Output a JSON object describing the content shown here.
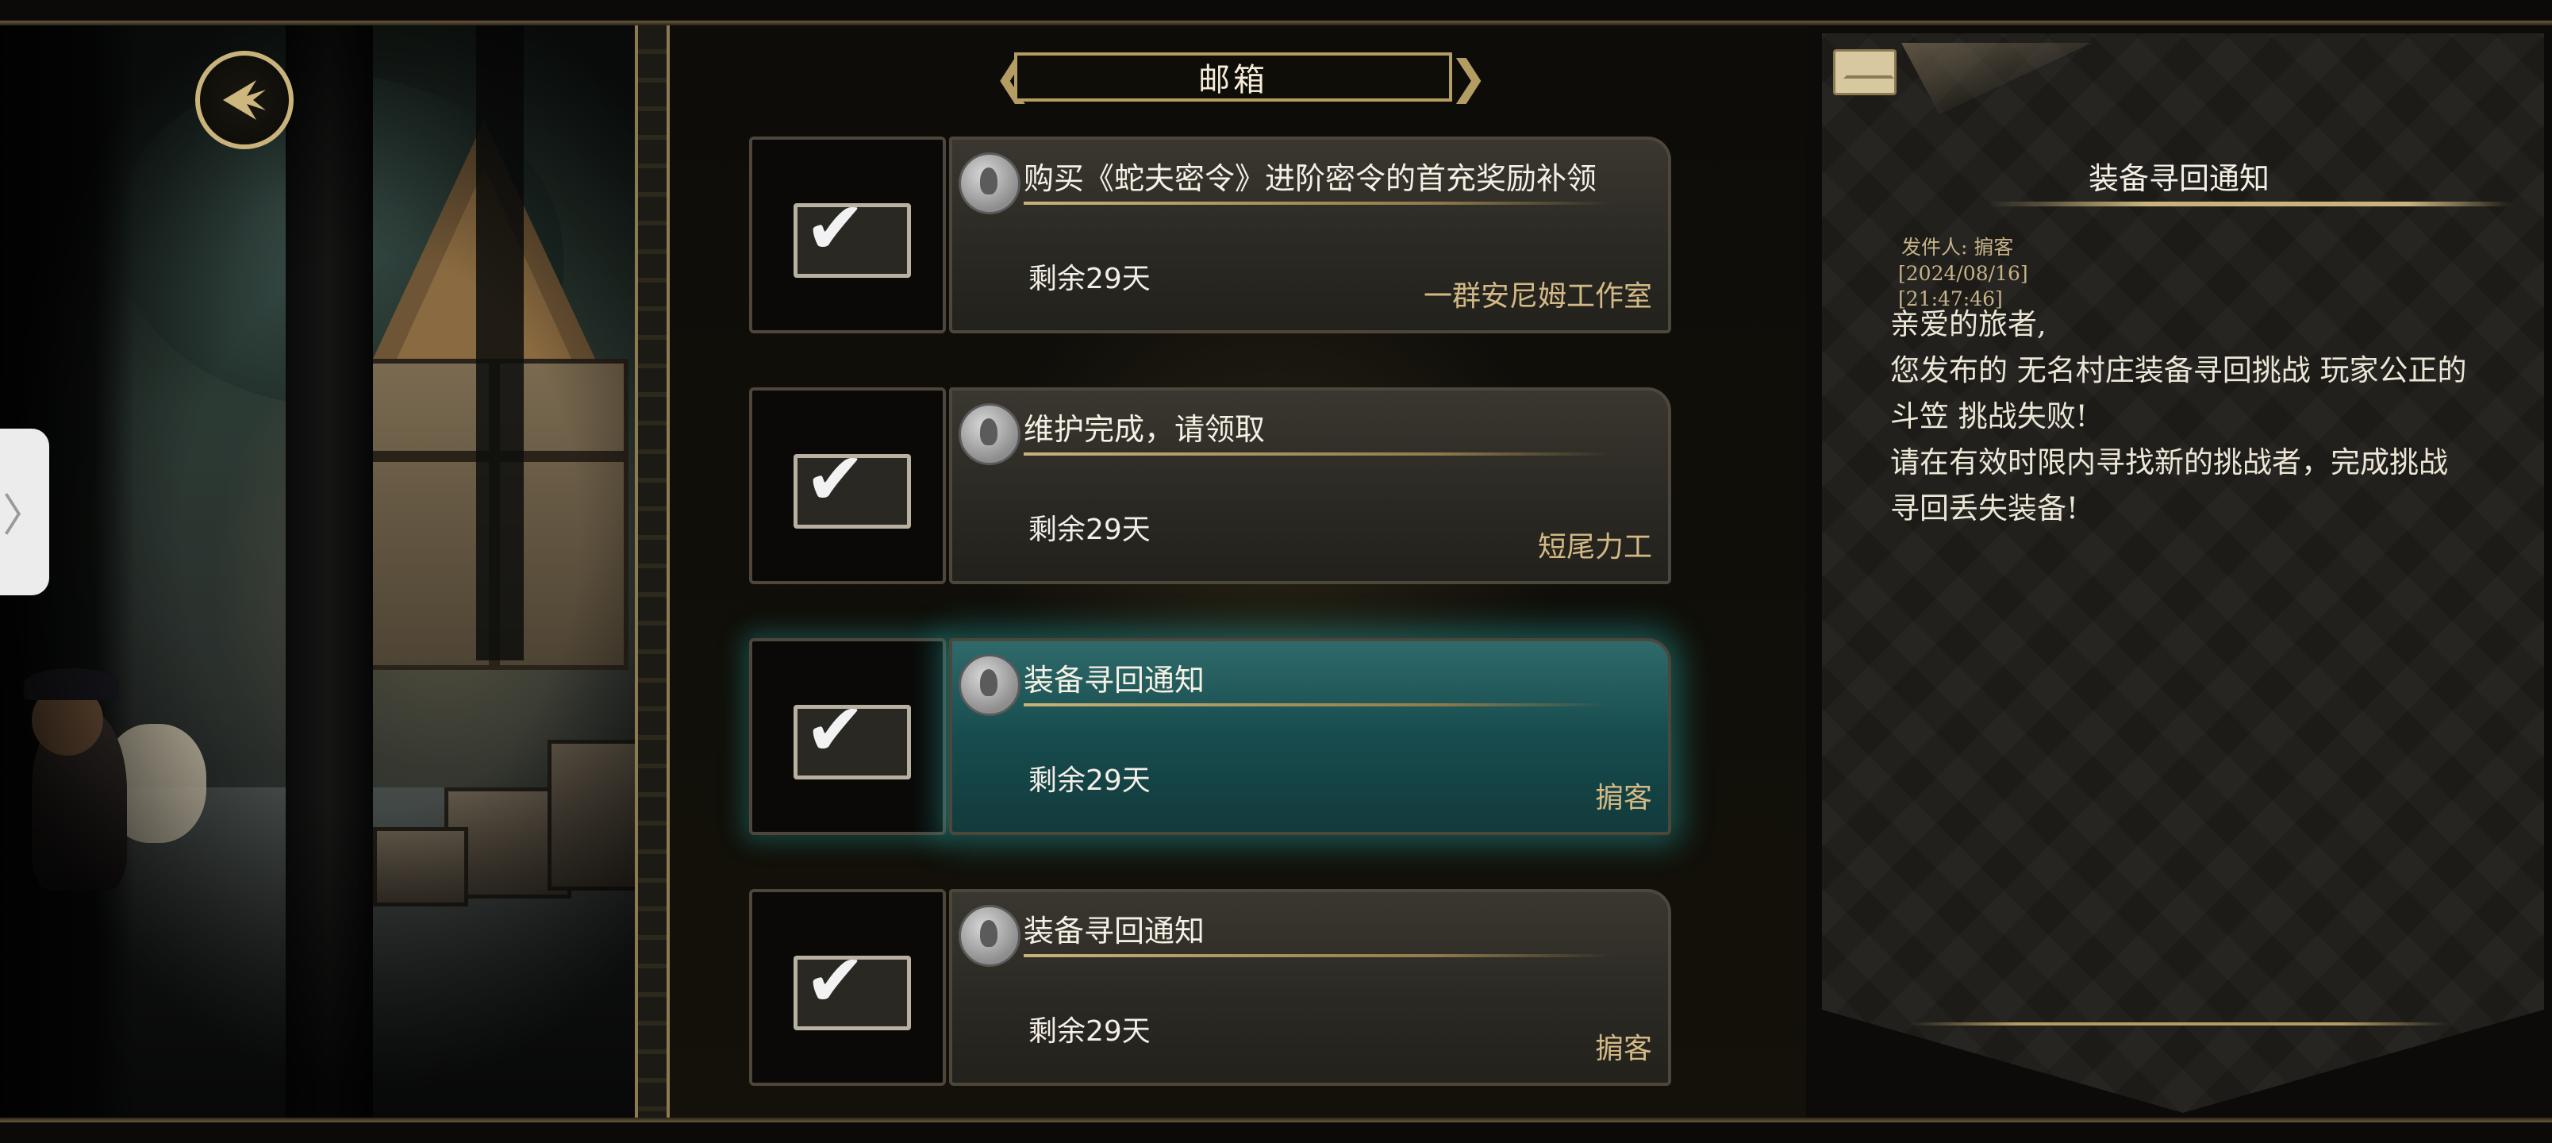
{
  "window": {
    "title": "邮箱"
  },
  "mails": [
    {
      "subject": "购买《蛇夫密令》进阶密令的首充奖励补领",
      "remaining": "剩余29天",
      "sender": "一群安尼姆工作室",
      "selected": false
    },
    {
      "subject": "维护完成，请领取",
      "remaining": "剩余29天",
      "sender": "短尾力工",
      "selected": false
    },
    {
      "subject": "装备寻回通知",
      "remaining": "剩余29天",
      "sender": "掮客",
      "selected": true
    },
    {
      "subject": "装备寻回通知",
      "remaining": "剩余29天",
      "sender": "掮客",
      "selected": false
    }
  ],
  "detail": {
    "title": "装备寻回通知",
    "sender_line": "发件人: 掮客",
    "date": "[2024/08/16]",
    "time": "[21:47:46]",
    "body": [
      "亲爱的旅者,",
      "您发布的 无名村庄装备寻回挑战 玩家公正的斗笠 挑战失败!",
      "请在有效时限内寻找新的挑战者，完成挑战寻回丢失装备!"
    ]
  },
  "icons": {
    "back": "back-arrow-icon",
    "mail_status": "checkmark-envelope-icon",
    "seal": "wax-seal-icon",
    "detail_envelope": "envelope-icon",
    "side_handle": "chevron-right-icon"
  },
  "colors": {
    "gold_trim": "#b49d63",
    "selected_glow": "#28aaaa",
    "sender_text": "#d3b985"
  }
}
